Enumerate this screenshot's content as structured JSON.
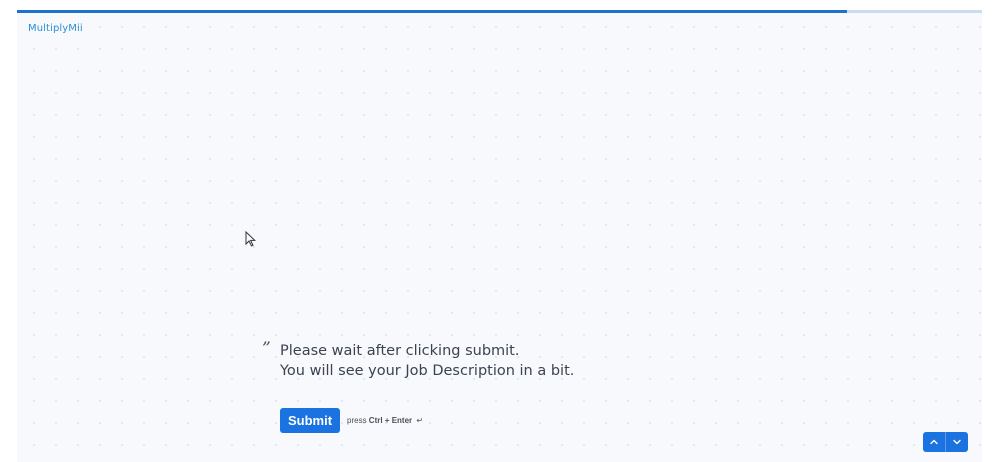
{
  "brand": {
    "logo_text": "MultiplyMii"
  },
  "progress": {
    "fraction": 0.86
  },
  "question": {
    "quote_mark": "”",
    "line1": "Please wait after clicking submit.",
    "line2": "You will see your Job Description in a bit."
  },
  "actions": {
    "submit_label": "Submit",
    "hint_prefix": "press",
    "hint_keys": "Ctrl + Enter",
    "hint_icon": "↵"
  },
  "navigation": {
    "up_icon": "chevron-up-icon",
    "down_icon": "chevron-down-icon"
  },
  "colors": {
    "accent": "#1a73e0",
    "progress_fill": "#1f72c9",
    "progress_track": "#c9ddf2",
    "logo": "#2e8fd6",
    "background": "#f7f9fc"
  }
}
